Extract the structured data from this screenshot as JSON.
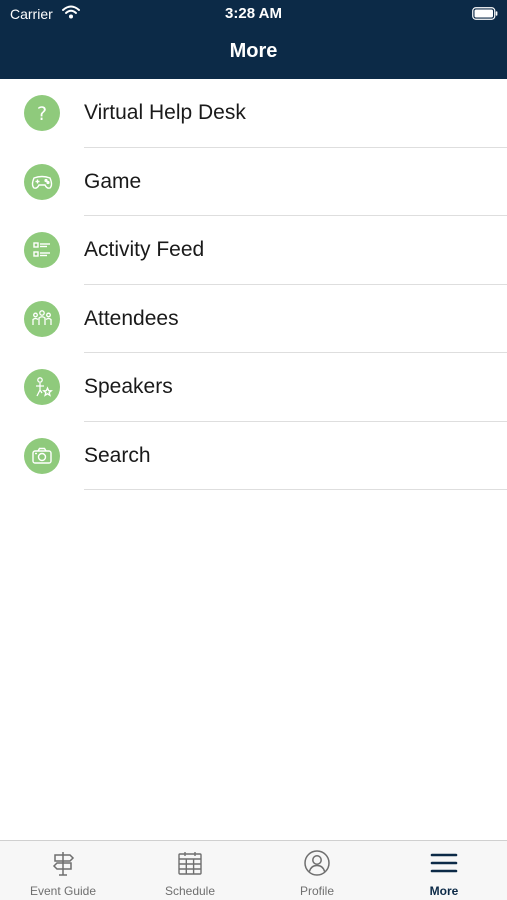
{
  "status_bar": {
    "carrier": "Carrier",
    "time": "3:28 AM"
  },
  "nav": {
    "title": "More"
  },
  "menu": {
    "items": [
      {
        "label": "Virtual Help Desk",
        "icon": "question-icon"
      },
      {
        "label": "Game",
        "icon": "gamepad-icon"
      },
      {
        "label": "Activity Feed",
        "icon": "list-icon"
      },
      {
        "label": "Attendees",
        "icon": "people-icon"
      },
      {
        "label": "Speakers",
        "icon": "speaker-star-icon"
      },
      {
        "label": "Search",
        "icon": "camera-icon"
      }
    ]
  },
  "tab_bar": {
    "tabs": [
      {
        "label": "Event Guide",
        "icon": "signpost-icon"
      },
      {
        "label": "Schedule",
        "icon": "calendar-icon"
      },
      {
        "label": "Profile",
        "icon": "profile-icon"
      },
      {
        "label": "More",
        "icon": "hamburger-menu-icon",
        "active": true
      }
    ]
  },
  "colors": {
    "header": "#0c2a47",
    "icon_circle": "#8fca7c",
    "active_tab": "#0c2a47",
    "inactive_tab": "#6f6f6f"
  }
}
